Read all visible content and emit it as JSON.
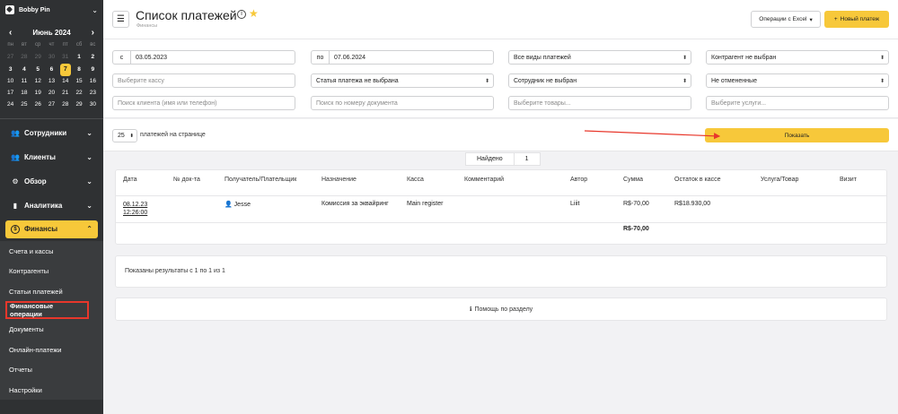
{
  "brand": {
    "name": "Bobby Pin"
  },
  "calendar": {
    "month": "Июнь 2024",
    "weekdays": [
      "пн",
      "вт",
      "ср",
      "чт",
      "пт",
      "сб",
      "вс"
    ],
    "weeks": [
      [
        "27",
        "28",
        "29",
        "30",
        "31",
        "1",
        "2"
      ],
      [
        "3",
        "4",
        "5",
        "6",
        "7",
        "8",
        "9"
      ],
      [
        "10",
        "11",
        "12",
        "13",
        "14",
        "15",
        "16"
      ],
      [
        "17",
        "18",
        "19",
        "20",
        "21",
        "22",
        "23"
      ],
      [
        "24",
        "25",
        "26",
        "27",
        "28",
        "29",
        "30"
      ]
    ],
    "today": "7"
  },
  "nav": {
    "items": [
      {
        "label": "Сотрудники",
        "icon": "user-group-icon"
      },
      {
        "label": "Клиенты",
        "icon": "users-icon"
      },
      {
        "label": "Обзор",
        "icon": "gear-icon"
      },
      {
        "label": "Аналитика",
        "icon": "chart-icon"
      },
      {
        "label": "Финансы",
        "icon": "dollar-icon"
      }
    ],
    "sub_items": [
      "Счета и кассы",
      "Контрагенты",
      "Статьи платежей",
      "Финансовые операции",
      "Документы",
      "Онлайн-платежи",
      "Отчеты",
      "Настройки"
    ]
  },
  "header": {
    "title": "Список платежей",
    "breadcrumb": "Финансы",
    "excel_label": "Операции с Excel",
    "new_label": "Новый платеж"
  },
  "filters": {
    "from_prefix": "с",
    "from_date": "03.05.2023",
    "to_prefix": "по",
    "to_date": "07.06.2024",
    "payment_types": "Все виды платежей",
    "counterparty": "Контрагент не выбран",
    "cashbox_placeholder": "Выберите кассу",
    "article": "Статья платежа не выбрана",
    "employee": "Сотрудник не выбран",
    "cancelled": "Не отмененные",
    "client_search_placeholder": "Поиск клиента (имя или телефон)",
    "doc_search_placeholder": "Поиск по номеру документа",
    "goods_placeholder": "Выберите товары...",
    "services_placeholder": "Выберите услуги..."
  },
  "pager": {
    "per_page": "25",
    "per_page_label": "платежей на странице",
    "show_label": "Показать"
  },
  "found": {
    "label": "Найдено",
    "count": "1"
  },
  "table": {
    "columns": [
      "Дата",
      "№ док-та",
      "Получатель/Плательщик",
      "Назначение",
      "Касса",
      "Комментарий",
      "Автор",
      "Сумма",
      "Остаток в кассе",
      "Услуга/Товар",
      "Визит"
    ],
    "rows": [
      {
        "date": "08.12.23",
        "time": "12:26:00",
        "doc": "",
        "recipient": "Jesse",
        "purpose": "Комиссия за эквайринг",
        "cashbox": "Main register",
        "comment": "",
        "author": "Liiit",
        "amount": "R$-70,00",
        "balance": "R$18.930,00"
      }
    ],
    "total": "R$-70,00"
  },
  "results_text": "Показаны результаты с 1 по 1 из 1",
  "help_text": "Помощь по разделу",
  "colors": {
    "accent": "#f7c83a",
    "sidebar": "#2f3133",
    "highlight": "#e8372b"
  }
}
